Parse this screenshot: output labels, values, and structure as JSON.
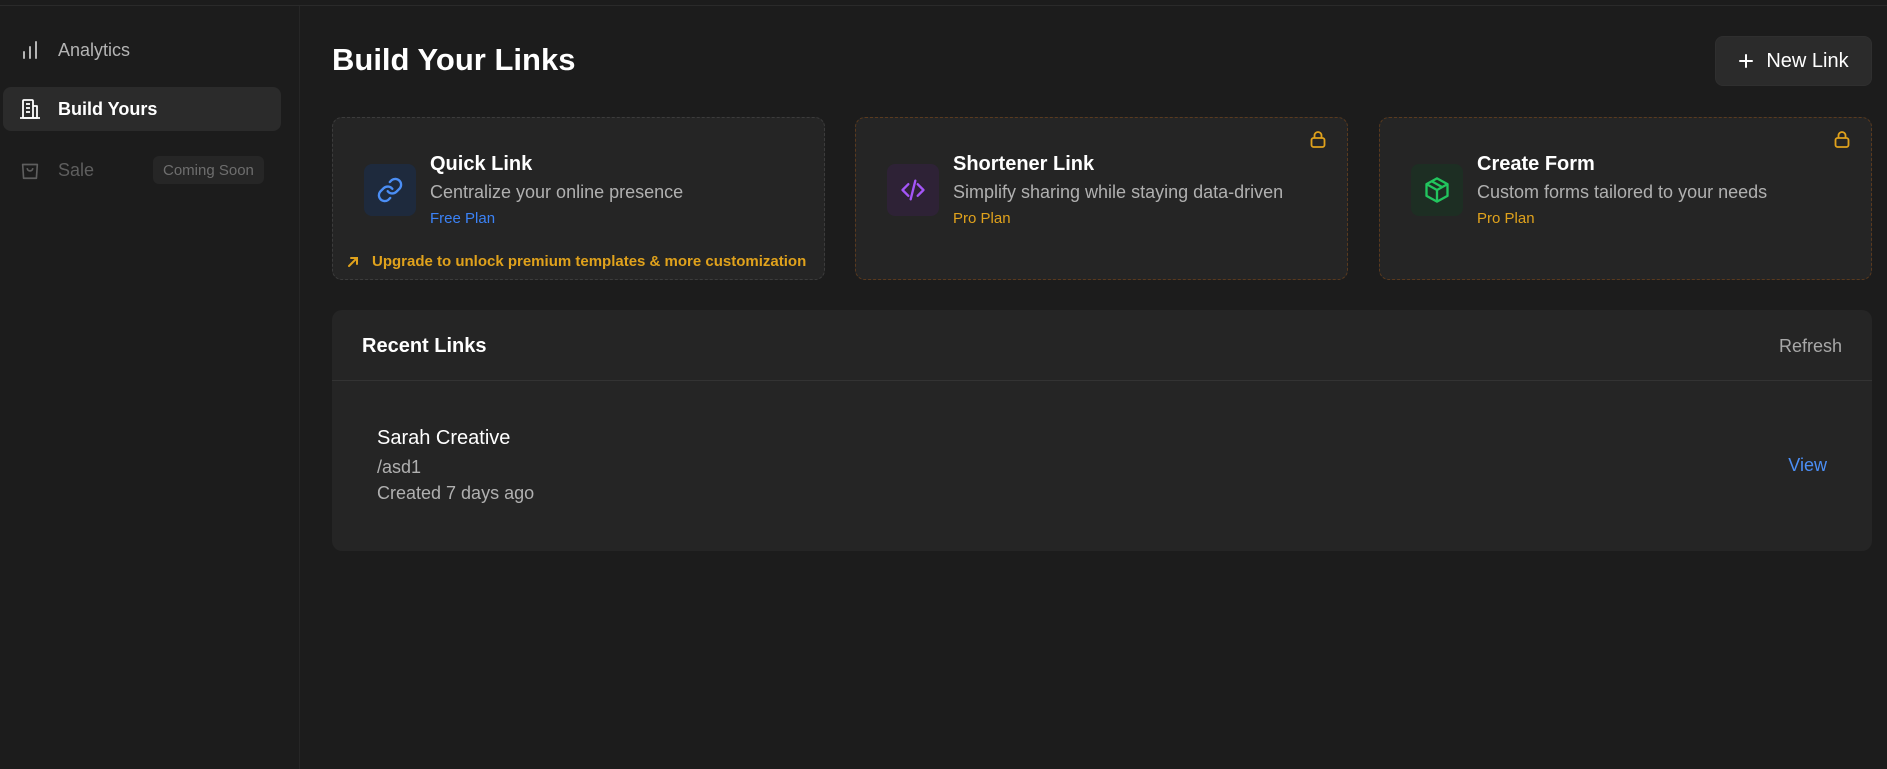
{
  "sidebar": {
    "items": [
      {
        "label": "Analytics",
        "icon": "bar-chart-icon",
        "state": "normal"
      },
      {
        "label": "Build Yours",
        "icon": "building-icon",
        "state": "active"
      },
      {
        "label": "Sale",
        "icon": "shopping-bag-icon",
        "state": "disabled",
        "badge": "Coming Soon"
      }
    ]
  },
  "header": {
    "title": "Build Your Links",
    "new_link_label": "New Link"
  },
  "cards": [
    {
      "title": "Quick Link",
      "description": "Centralize your online presence",
      "plan": "Free Plan",
      "plan_color": "#3b82f6",
      "icon": "link-icon",
      "icon_color": "#4b8ef5",
      "locked": false,
      "upgrade": "Upgrade to unlock premium templates & more customization"
    },
    {
      "title": "Shortener Link",
      "description": "Simplify sharing while staying data-driven",
      "plan": "Pro Plan",
      "plan_color": "#e0a21c",
      "icon": "code-icon",
      "icon_color": "#a455f7",
      "locked": true
    },
    {
      "title": "Create Form",
      "description": "Custom forms tailored to your needs",
      "plan": "Pro Plan",
      "plan_color": "#e0a21c",
      "icon": "box-icon",
      "icon_color": "#22c55e",
      "locked": true
    }
  ],
  "recent": {
    "title": "Recent Links",
    "refresh_label": "Refresh",
    "links": [
      {
        "name": "Sarah Creative",
        "slug": "/asd1",
        "created": "Created 7 days ago",
        "view_label": "View"
      }
    ]
  },
  "colors": {
    "background": "#1c1c1c",
    "card": "#252525",
    "accent_blue": "#4b8ef5",
    "accent_gold": "#e0a21c"
  }
}
